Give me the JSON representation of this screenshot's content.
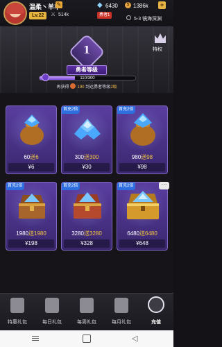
{
  "player": {
    "name": "温柔丶羊羊",
    "level": "Lv.22",
    "power": "514k",
    "hero_badge": "勇者1"
  },
  "currencies": {
    "diamonds": "6430",
    "coins": "1386k"
  },
  "location": "5-3 镜海深渊",
  "header": {
    "privilege_label": "特权",
    "hero_level_number": "1",
    "hero_title": "勇者等级",
    "exp_text": "110/300",
    "exp_progress": 0.367,
    "hint_prefix": "再获得",
    "hint_amount": "190",
    "hint_suffix": "到达勇者等级",
    "hint_target": "2级"
  },
  "packs": [
    {
      "amount": "60",
      "bonus_label": "送",
      "bonus": "6",
      "price": "¥6",
      "first_double": "",
      "art": "diamond-bag-icon"
    },
    {
      "amount": "300",
      "bonus_label": "送",
      "bonus": "300",
      "price": "¥30",
      "first_double": "首充2倍",
      "art": "diamond-pile-icon"
    },
    {
      "amount": "980",
      "bonus_label": "送",
      "bonus": "98",
      "price": "¥98",
      "first_double": "首充2倍",
      "art": "diamond-bag-icon"
    },
    {
      "amount": "1980",
      "bonus_label": "送",
      "bonus": "1980",
      "price": "¥198",
      "first_double": "首充2倍",
      "art": "treasure-chest-icon"
    },
    {
      "amount": "3280",
      "bonus_label": "送",
      "bonus": "3280",
      "price": "¥328",
      "first_double": "首充2倍",
      "art": "treasure-chest-icon"
    },
    {
      "amount": "6480",
      "bonus_label": "送",
      "bonus": "6480",
      "price": "¥648",
      "first_double": "首充2倍",
      "art": "golden-chest-icon"
    }
  ],
  "tabs": [
    {
      "label": "特惠礼包",
      "icon": "bag-icon",
      "active": false
    },
    {
      "label": "每日礼包",
      "icon": "gift-box-icon",
      "active": false
    },
    {
      "label": "每周礼包",
      "icon": "gift-box-icon",
      "active": false
    },
    {
      "label": "每月礼包",
      "icon": "gift-box-icon",
      "active": false
    },
    {
      "label": "充值",
      "icon": "crown-icon",
      "active": true
    }
  ],
  "colors": {
    "card_purple": "#5a3ea0",
    "bonus_gold": "#f5c542",
    "badge_blue": "#2e6ee0",
    "level_gold": "#e6b53f"
  }
}
